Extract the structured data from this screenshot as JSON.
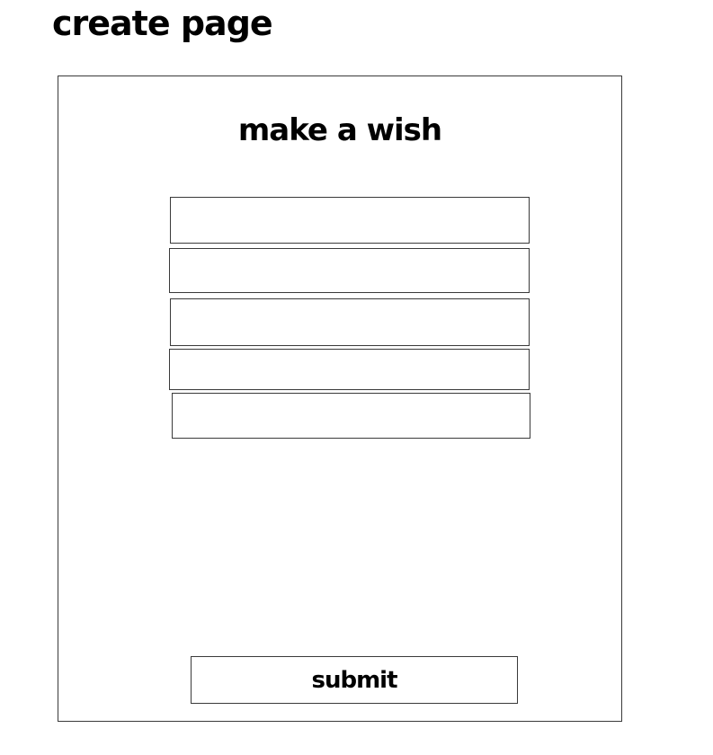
{
  "page": {
    "heading": "create page"
  },
  "form": {
    "title": "make a wish",
    "fields": [
      {
        "value": ""
      },
      {
        "value": ""
      },
      {
        "value": ""
      },
      {
        "value": ""
      },
      {
        "value": ""
      }
    ],
    "submit_label": "submit"
  },
  "colors": {
    "background": "#ffffff",
    "border": "#3a3a3a",
    "text": "#000000"
  }
}
